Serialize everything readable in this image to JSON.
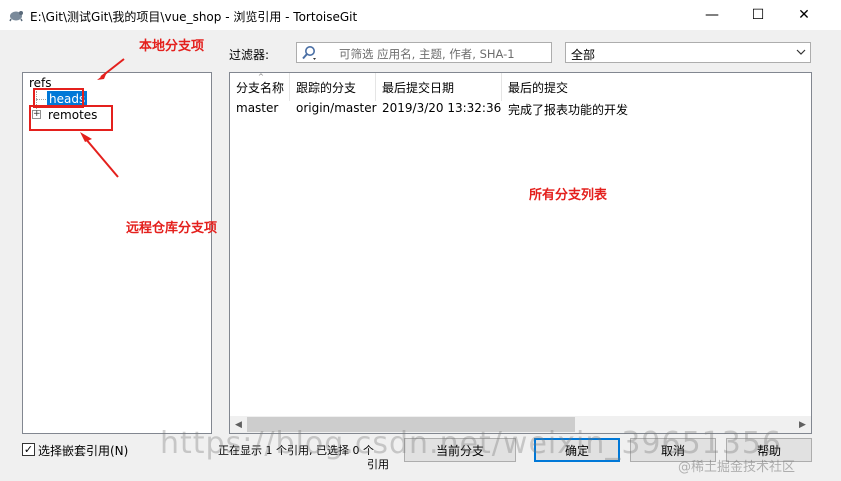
{
  "window": {
    "title": "E:\\Git\\测试Git\\我的项目\\vue_shop - 浏览引用 - TortoiseGit",
    "minimize": "—",
    "maximize": "☐",
    "close": "✕"
  },
  "filter": {
    "label": "过滤器:",
    "placeholder": "可筛选 应用名, 主题, 作者, SHA-1",
    "scope": "全部"
  },
  "tree": {
    "root": "refs",
    "items": [
      {
        "label": "heads",
        "selected": true
      },
      {
        "label": "remotes",
        "expandable": true
      }
    ]
  },
  "grid": {
    "columns": [
      "分支名称",
      "跟踪的分支",
      "最后提交日期",
      "最后的提交"
    ],
    "rows": [
      [
        "master",
        "origin/master",
        "2019/3/20 13:32:36",
        "完成了报表功能的开发"
      ]
    ]
  },
  "footer": {
    "checkbox_label": "选择嵌套引用(N)",
    "checkbox_checked": true,
    "status_line1": "正在显示 1 个引用, 已选择 0 个",
    "status_line2": "引用",
    "buttons": {
      "current_branch": "当前分支",
      "ok": "确定",
      "cancel": "取消",
      "help": "帮助"
    }
  },
  "annotations": {
    "local_branch": "本地分支项",
    "remote_branch": "远程仓库分支项",
    "all_branches": "所有分支列表"
  },
  "watermark": {
    "url": "https://blog.csdn.net/weixin_39651356",
    "site": "@稀土掘金技术社区"
  },
  "colors": {
    "selection": "#0078d7",
    "annotation": "#e4201d"
  }
}
